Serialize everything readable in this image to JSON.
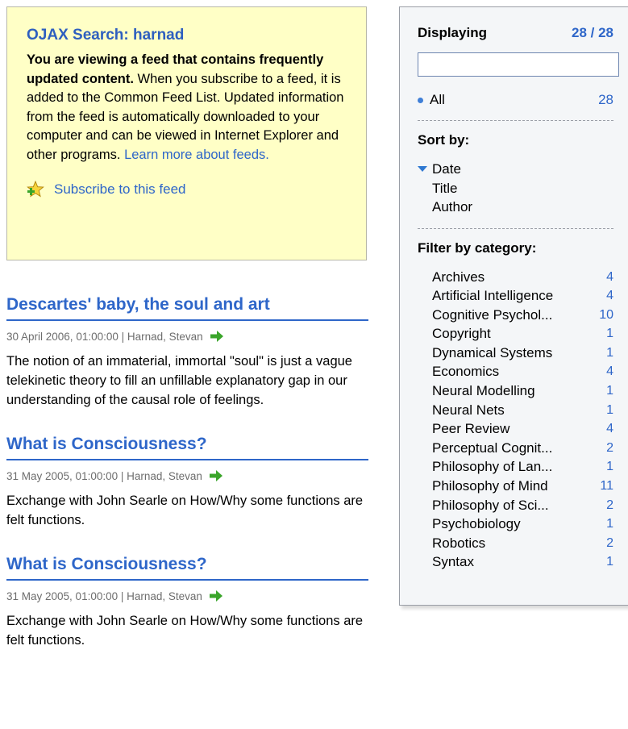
{
  "infobox": {
    "title": "OJAX Search: harnad",
    "lead": "You are viewing a feed that contains frequently updated content.",
    "body": " When you subscribe to a feed, it is added to the Common Feed List. Updated information from the feed is automatically downloaded to your computer and can be viewed in Internet Explorer and other programs. ",
    "learn_more": "Learn more about feeds.",
    "subscribe_label": "Subscribe to this feed"
  },
  "entries": [
    {
      "title": "Descartes' baby, the soul and art",
      "meta": "30 April 2006, 01:00:00 | Harnad, Stevan",
      "body": "The notion of an immaterial, immortal \"soul\" is just a vague telekinetic theory to fill an unfillable explanatory gap in our understanding of the causal role of feelings."
    },
    {
      "title": "What is Consciousness?",
      "meta": "31 May 2005, 01:00:00 | Harnad, Stevan",
      "body": "Exchange with John Searle on How/Why some functions are felt functions."
    },
    {
      "title": "What is Consciousness?",
      "meta": "31 May 2005, 01:00:00 | Harnad, Stevan",
      "body": "Exchange with John Searle on How/Why some functions are felt functions."
    }
  ],
  "sidebar": {
    "displaying_label": "Displaying",
    "displaying_count": "28 / 28",
    "filter_input_value": "",
    "all_label": "All",
    "all_count": "28",
    "sort_label": "Sort by:",
    "sort_options": [
      "Date",
      "Title",
      "Author"
    ],
    "sort_selected": "Date",
    "filter_label": "Filter by category:",
    "categories": [
      {
        "name": "Archives",
        "count": "4"
      },
      {
        "name": "Artificial Intelligence",
        "count": "4"
      },
      {
        "name": "Cognitive Psychol...",
        "count": "10"
      },
      {
        "name": "Copyright",
        "count": "1"
      },
      {
        "name": "Dynamical Systems",
        "count": "1"
      },
      {
        "name": "Economics",
        "count": "4"
      },
      {
        "name": "Neural Modelling",
        "count": "1"
      },
      {
        "name": "Neural Nets",
        "count": "1"
      },
      {
        "name": "Peer Review",
        "count": "4"
      },
      {
        "name": "Perceptual Cognit...",
        "count": "2"
      },
      {
        "name": "Philosophy of Lan...",
        "count": "1"
      },
      {
        "name": "Philosophy of Mind",
        "count": "11"
      },
      {
        "name": "Philosophy of Sci...",
        "count": "2"
      },
      {
        "name": "Psychobiology",
        "count": "1"
      },
      {
        "name": "Robotics",
        "count": "2"
      },
      {
        "name": "Syntax",
        "count": "1"
      }
    ]
  },
  "icons": {
    "subscribe": "star-plus-icon",
    "entry_link": "green-arrow-icon",
    "sort_indicator": "triangle-down-icon"
  },
  "colors": {
    "link": "#2e66c9",
    "infobox_bg": "#ffffc6",
    "sidebar_bg": "#f4f6f8",
    "arrow": "#3aa52a"
  }
}
